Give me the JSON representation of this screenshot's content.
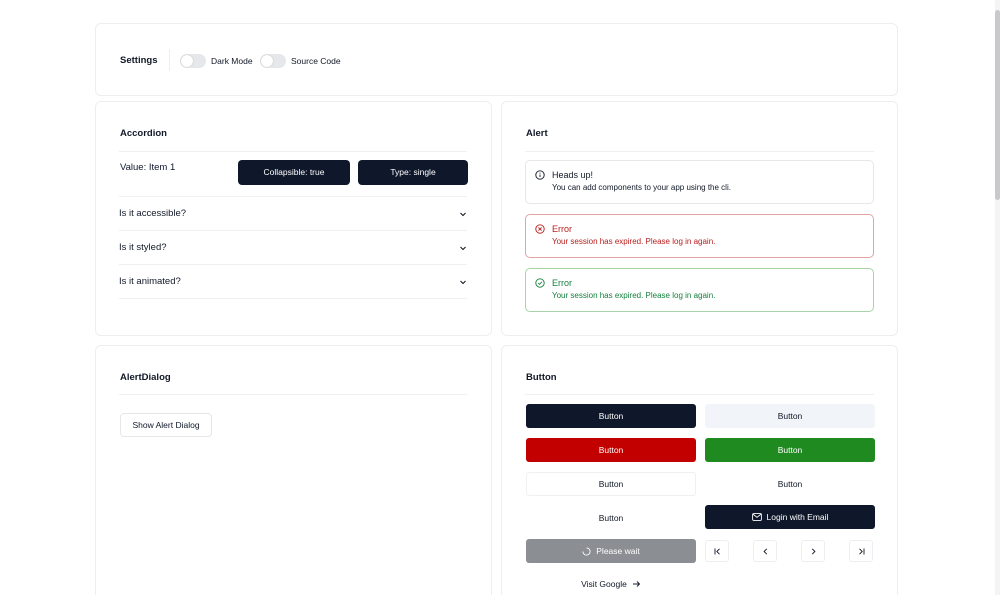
{
  "settings": {
    "title": "Settings",
    "dark_mode_label": "Dark Mode",
    "source_code_label": "Source Code"
  },
  "accordion": {
    "title": "Accordion",
    "value_text": "Value: Item 1",
    "collapsible_btn": "Collapsible: true",
    "type_btn": "Type: single",
    "items": [
      {
        "label": "Is it accessible?"
      },
      {
        "label": "Is it styled?"
      },
      {
        "label": "Is it animated?"
      }
    ]
  },
  "alert": {
    "title": "Alert",
    "items": [
      {
        "title": "Heads up!",
        "desc": "You can add components to your app using the cli.",
        "variant": "default",
        "color": "#111827"
      },
      {
        "title": "Error",
        "desc": "Your session has expired. Please log in again.",
        "variant": "destructive",
        "color": "#b91c1c"
      },
      {
        "title": "Error",
        "desc": "Your session has expired. Please log in again.",
        "variant": "success",
        "color": "#15803d"
      }
    ]
  },
  "alert_dialog": {
    "title": "AlertDialog",
    "button": "Show Alert Dialog"
  },
  "button": {
    "title": "Button",
    "labels": {
      "primary": "Button",
      "secondary": "Button",
      "destructive": "Button",
      "success": "Button",
      "outline": "Button",
      "ghost": "Button",
      "link": "Button",
      "login": "Login with Email",
      "loading": "Please wait",
      "visit": "Visit Google"
    },
    "colors": {
      "primary": "#0f172a",
      "secondary": "#f1f5f9",
      "destructive": "#c20000",
      "success": "#1f8a1f",
      "disabled": "#8b8e93"
    }
  }
}
